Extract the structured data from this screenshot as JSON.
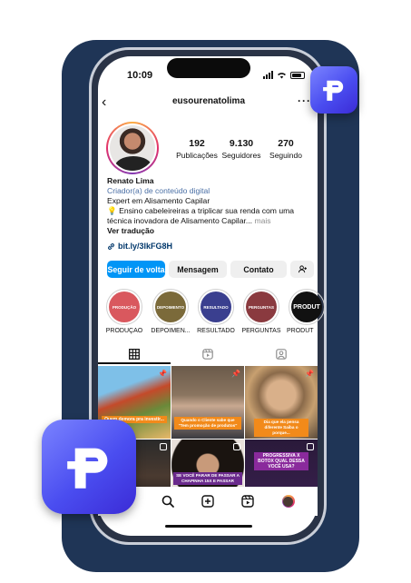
{
  "status": {
    "time": "10:09"
  },
  "header": {
    "username": "eusourenatolima",
    "more": "···",
    "back": "‹"
  },
  "stats": [
    {
      "value": "192",
      "label": "Publicações"
    },
    {
      "value": "9.130",
      "label": "Seguidores"
    },
    {
      "value": "270",
      "label": "Seguindo"
    }
  ],
  "bio": {
    "name": "Renato Lima",
    "category": "Criador(a) de conteúdo digital",
    "line1": "Expert em Alisamento Capilar",
    "line2": "💡 Ensino cabeleireiras a triplicar sua renda com uma",
    "line3": "técnica inovadora de Alisamento Capilar...",
    "more": "mais",
    "translate": "Ver tradução",
    "link": "bit.ly/3lkFG8H"
  },
  "buttons": {
    "follow": "Seguir de volta",
    "message": "Mensagem",
    "contact": "Contato",
    "add": "+👤"
  },
  "highlights": [
    {
      "label": "PRODUÇÃO",
      "inner": "PRODUÇÃO",
      "color": "#d9585e"
    },
    {
      "label": "DEPOIMEN...",
      "inner": "DEPOIMENTO",
      "color": "#7b6a3a"
    },
    {
      "label": "RESULTADO",
      "inner": "RESULTADO",
      "color": "#3a3f8f"
    },
    {
      "label": "PERGUNTAS",
      "inner": "PERGUNTAS",
      "color": "#8a3a3f"
    },
    {
      "label": "PRODUT",
      "inner": "PRODUT",
      "color": "#111111"
    }
  ],
  "posts": [
    {
      "caption": "Quem demora pra investir...",
      "style": "orange"
    },
    {
      "caption": "Quando o Cliente sabe que \"Tem promoção de produtos\"",
      "style": "orange"
    },
    {
      "caption": "Dia que ela pensa diferente Saiba o porque...",
      "style": "orange"
    },
    {
      "caption": "",
      "style": "none"
    },
    {
      "caption": "SE VOCÊ PARAR DE PASSAR A CHAPINHA 15X E PASSAR",
      "style": "purple"
    },
    {
      "caption": "PROGRESSIVA X BOTOX QUAL DESSA VOCÊ USA?",
      "style": "purple"
    }
  ],
  "colors": {
    "accent": "#0095f6",
    "bg_panel": "#1f3556",
    "logo": "#4a4df0"
  },
  "icons": [
    "grid-icon",
    "reels-icon",
    "tagged-icon",
    "home-icon",
    "search-icon",
    "add-icon",
    "reels-nav-icon",
    "profile-icon"
  ]
}
